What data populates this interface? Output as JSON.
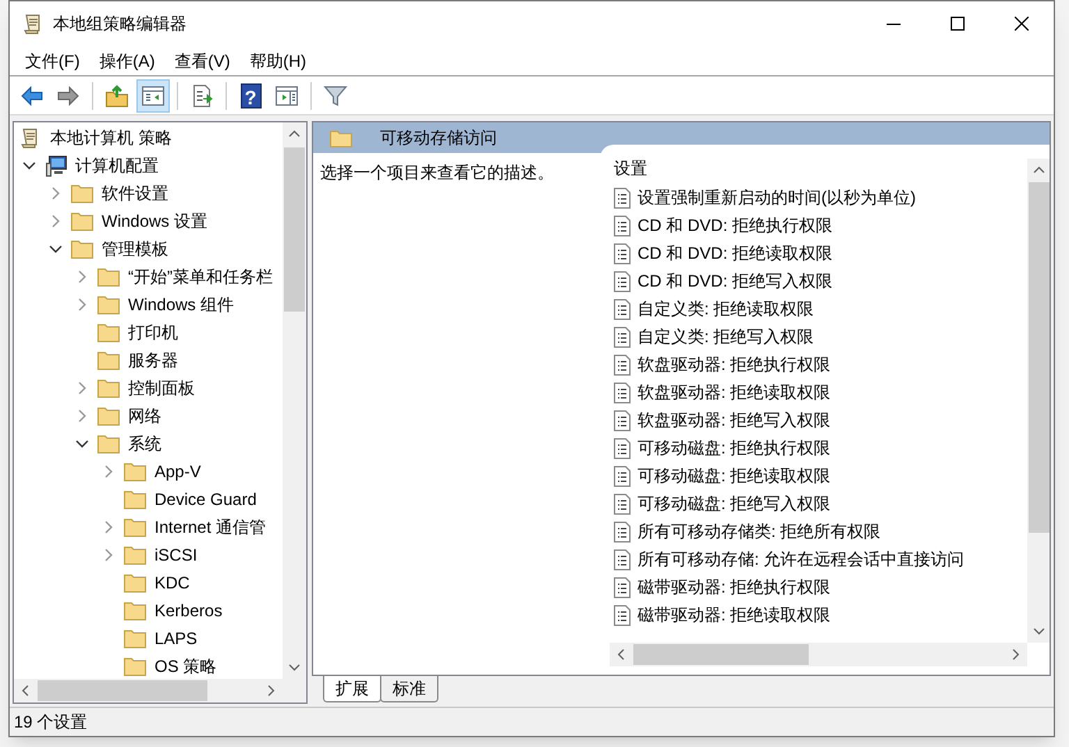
{
  "window": {
    "title": "本地组策略编辑器"
  },
  "menu": [
    "文件(F)",
    "操作(A)",
    "查看(V)",
    "帮助(H)"
  ],
  "toolbar": [
    {
      "kind": "back",
      "selected": false
    },
    {
      "kind": "forward",
      "selected": false
    },
    {
      "kind": "sep"
    },
    {
      "kind": "up",
      "selected": false
    },
    {
      "kind": "tree",
      "selected": true
    },
    {
      "kind": "sep"
    },
    {
      "kind": "export",
      "selected": false
    },
    {
      "kind": "sep"
    },
    {
      "kind": "help",
      "glyph": "?",
      "selected": false
    },
    {
      "kind": "pane",
      "selected": false
    },
    {
      "kind": "sep"
    },
    {
      "kind": "filter",
      "selected": false
    }
  ],
  "tree": [
    {
      "label": "本地计算机 策略",
      "kind": "root",
      "children": [
        {
          "label": "计算机配置",
          "kind": "computer",
          "expanded": true,
          "children": [
            {
              "label": "软件设置",
              "kind": "folder",
              "expanded": false
            },
            {
              "label": "Windows 设置",
              "kind": "folder",
              "expanded": false
            },
            {
              "label": "管理模板",
              "kind": "folder",
              "expanded": true,
              "children": [
                {
                  "label": "“开始”菜单和任务栏",
                  "kind": "folder",
                  "expanded": false
                },
                {
                  "label": "Windows 组件",
                  "kind": "folder",
                  "expanded": false
                },
                {
                  "label": "打印机",
                  "kind": "folder"
                },
                {
                  "label": "服务器",
                  "kind": "folder"
                },
                {
                  "label": "控制面板",
                  "kind": "folder",
                  "expanded": false
                },
                {
                  "label": "网络",
                  "kind": "folder",
                  "expanded": false
                },
                {
                  "label": "系统",
                  "kind": "folder",
                  "expanded": true,
                  "children": [
                    {
                      "label": "App-V",
                      "kind": "folder",
                      "expanded": false
                    },
                    {
                      "label": "Device Guard",
                      "kind": "folder"
                    },
                    {
                      "label": "Internet 通信管",
                      "kind": "folder",
                      "expanded": false
                    },
                    {
                      "label": "iSCSI",
                      "kind": "folder",
                      "expanded": false
                    },
                    {
                      "label": "KDC",
                      "kind": "folder"
                    },
                    {
                      "label": "Kerberos",
                      "kind": "folder"
                    },
                    {
                      "label": "LAPS",
                      "kind": "folder"
                    },
                    {
                      "label": "OS 策略",
                      "kind": "folder"
                    }
                  ]
                }
              ]
            }
          ]
        }
      ]
    }
  ],
  "detail": {
    "title": "可移动存储访问",
    "description": "选择一个项目来查看它的描述。",
    "column": "设置",
    "settings": [
      "设置强制重新启动的时间(以秒为单位)",
      "CD 和 DVD: 拒绝执行权限",
      "CD 和 DVD: 拒绝读取权限",
      "CD 和 DVD: 拒绝写入权限",
      "自定义类: 拒绝读取权限",
      "自定义类: 拒绝写入权限",
      "软盘驱动器: 拒绝执行权限",
      "软盘驱动器: 拒绝读取权限",
      "软盘驱动器: 拒绝写入权限",
      "可移动磁盘: 拒绝执行权限",
      "可移动磁盘: 拒绝读取权限",
      "可移动磁盘: 拒绝写入权限",
      "所有可移动存储类: 拒绝所有权限",
      "所有可移动存储: 允许在远程会话中直接访问",
      "磁带驱动器: 拒绝执行权限",
      "磁带驱动器: 拒绝读取权限"
    ]
  },
  "tabs": [
    {
      "label": "扩展",
      "selected": true
    },
    {
      "label": "标准",
      "selected": false
    }
  ],
  "status_bar": "19 个设置"
}
